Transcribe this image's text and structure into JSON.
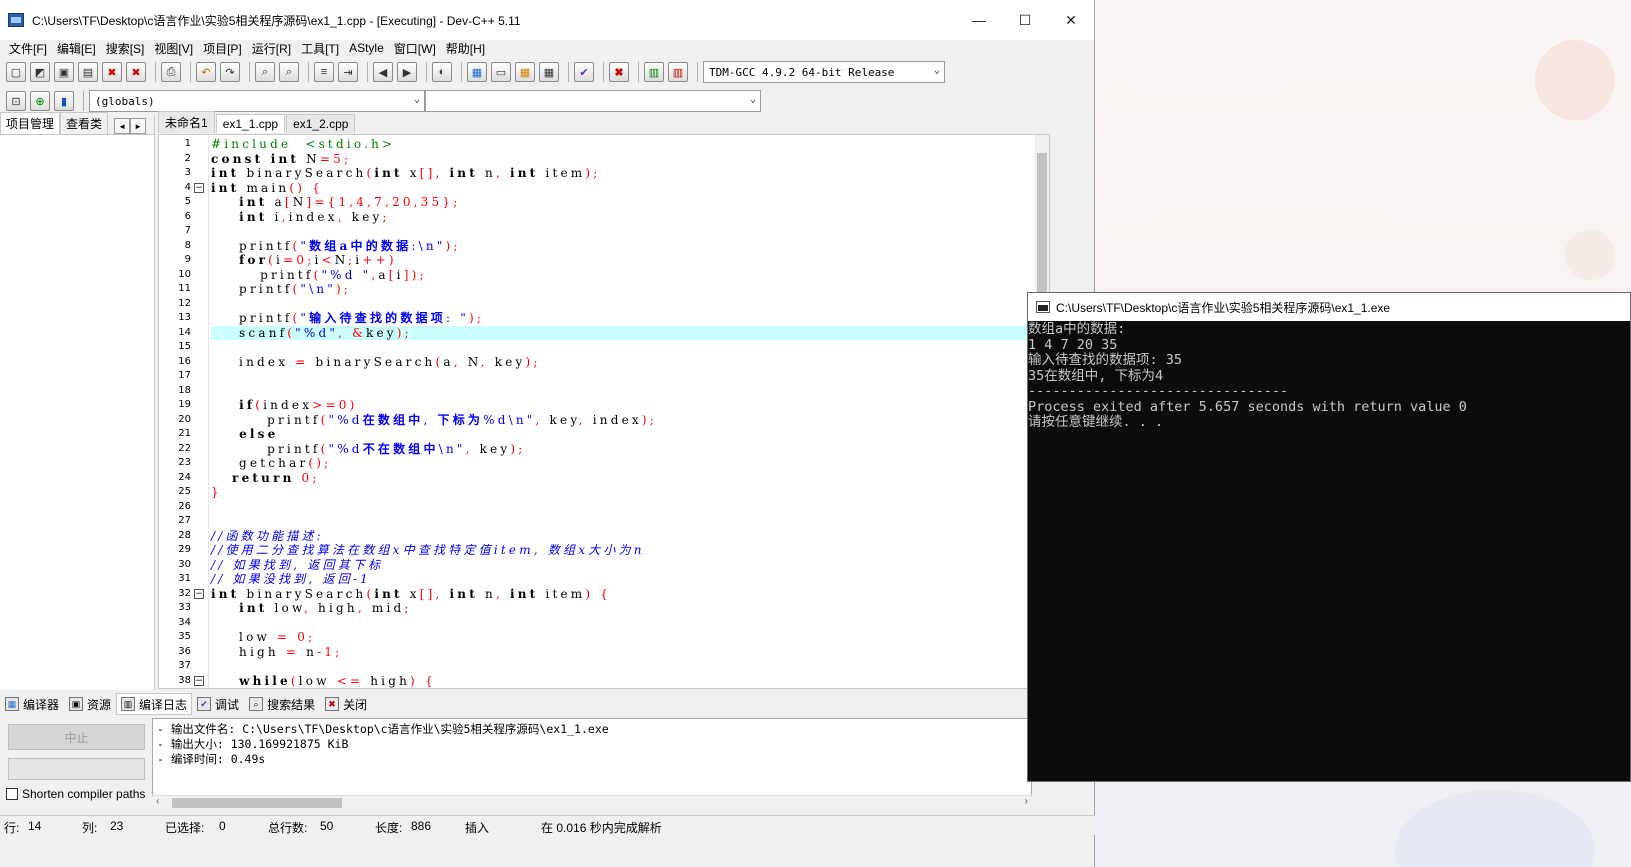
{
  "window": {
    "title": "C:\\Users\\TF\\Desktop\\c语言作业\\实验5相关程序源码\\ex1_1.cpp - [Executing] - Dev-C++ 5.11",
    "minimize": "—",
    "maximize": "☐",
    "close": "✕"
  },
  "menu": [
    "文件[F]",
    "编辑[E]",
    "搜索[S]",
    "视图[V]",
    "项目[P]",
    "运行[R]",
    "工具[T]",
    "AStyle",
    "窗口[W]",
    "帮助[H]"
  ],
  "toolbar": {
    "compiler_select": "TDM-GCC 4.9.2 64-bit Release",
    "class_select": "(globals)",
    "member_select": ""
  },
  "left_panel": {
    "tabs": [
      "项目管理",
      "查看类"
    ],
    "nav_prev": "◄",
    "nav_next": "►"
  },
  "editor": {
    "tabs": [
      "未命名1",
      "ex1_1.cpp",
      "ex1_2.cpp"
    ],
    "active_tab": 1,
    "highlight_line": 14
  },
  "code": [
    {
      "n": "1",
      "html": "<span class=\"pp\">#include  &lt;stdio.h&gt;</span>"
    },
    {
      "n": "2",
      "html": "<span class=\"kw\">const int</span> N<span class=\"sym\">=</span><span class=\"num\">5</span><span class=\"sym\">;</span>"
    },
    {
      "n": "3",
      "html": "<span class=\"kw\">int</span> binarySearch<span class=\"sym\">(</span><span class=\"kw\">int</span> x<span class=\"sym\">[],</span> <span class=\"kw\">int</span> n<span class=\"sym\">,</span> <span class=\"kw\">int</span> item<span class=\"sym\">);</span>"
    },
    {
      "n": "4",
      "fold": "−",
      "html": "<span class=\"kw\">int</span> main<span class=\"sym\">()</span> <span class=\"sym\">{</span>"
    },
    {
      "n": "5",
      "html": "    <span class=\"kw\">int</span> a<span class=\"sym\">[</span>N<span class=\"sym\">]={</span><span class=\"num\">1,4,7,20,35</span><span class=\"sym\">};</span>"
    },
    {
      "n": "6",
      "html": "    <span class=\"kw\">int</span> i<span class=\"sym\">,</span>index<span class=\"sym\">,</span> key<span class=\"sym\">;</span>"
    },
    {
      "n": "7",
      "html": ""
    },
    {
      "n": "8",
      "html": "    printf<span class=\"sym\">(</span><span class=\"str\">\"<b>数组a中的数据</b>:\\n\"</span><span class=\"sym\">);</span>"
    },
    {
      "n": "9",
      "html": "    <span class=\"kw\">for</span><span class=\"sym\">(</span>i<span class=\"sym\">=</span><span class=\"num\">0</span><span class=\"sym\">;</span>i<span class=\"sym\">&lt;</span>N<span class=\"sym\">;</span>i<span class=\"sym\">++)</span>"
    },
    {
      "n": "10",
      "html": "       printf<span class=\"sym\">(</span><span class=\"str\">\"%d \"</span><span class=\"sym\">,</span>a<span class=\"sym\">[</span>i<span class=\"sym\">]);</span>"
    },
    {
      "n": "11",
      "html": "    printf<span class=\"sym\">(</span><span class=\"str\">\"\\n\"</span><span class=\"sym\">);</span>"
    },
    {
      "n": "12",
      "html": ""
    },
    {
      "n": "13",
      "html": "    printf<span class=\"sym\">(</span><span class=\"str\">\"<b>输入待查找的数据项</b>: \"</span><span class=\"sym\">);</span>"
    },
    {
      "n": "14",
      "html": "    scanf<span class=\"sym\">(</span><span class=\"str\">\"%d\"</span><span class=\"sym\">,</span> <span class=\"sym\">&amp;</span>key<span class=\"sym\">);</span>"
    },
    {
      "n": "15",
      "html": ""
    },
    {
      "n": "16",
      "html": "    index <span class=\"sym\">=</span> binarySearch<span class=\"sym\">(</span>a<span class=\"sym\">,</span> N<span class=\"sym\">,</span> key<span class=\"sym\">);</span>"
    },
    {
      "n": "17",
      "html": ""
    },
    {
      "n": "18",
      "html": ""
    },
    {
      "n": "19",
      "html": "    <span class=\"kw\">if</span><span class=\"sym\">(</span>index<span class=\"sym\">&gt;=</span><span class=\"num\">0</span><span class=\"sym\">)</span>"
    },
    {
      "n": "20",
      "html": "        printf<span class=\"sym\">(</span><span class=\"str\">\"%d<b>在数组中</b>, <b>下标为</b>%d\\n\"</span><span class=\"sym\">,</span> key<span class=\"sym\">,</span> index<span class=\"sym\">);</span>"
    },
    {
      "n": "21",
      "html": "    <span class=\"kw\">else</span>"
    },
    {
      "n": "22",
      "html": "        printf<span class=\"sym\">(</span><span class=\"str\">\"%d<b>不在数组中</b>\\n\"</span><span class=\"sym\">,</span> key<span class=\"sym\">);</span>"
    },
    {
      "n": "23",
      "html": "    getchar<span class=\"sym\">();</span>"
    },
    {
      "n": "24",
      "html": "   <span class=\"kw\">return</span> <span class=\"num\">0</span><span class=\"sym\">;</span>"
    },
    {
      "n": "25",
      "html": "<span class=\"sym\">}</span>"
    },
    {
      "n": "26",
      "html": ""
    },
    {
      "n": "27",
      "html": ""
    },
    {
      "n": "28",
      "html": "<span class=\"cm\">//函数功能描述:</span>"
    },
    {
      "n": "29",
      "html": "<span class=\"cm\">//使用二分查找算法在数组x中查找特定值item, 数组x大小为n</span>"
    },
    {
      "n": "30",
      "html": "<span class=\"cm\">// 如果找到, 返回其下标</span>"
    },
    {
      "n": "31",
      "html": "<span class=\"cm\">// 如果没找到, 返回-1</span>"
    },
    {
      "n": "32",
      "fold": "−",
      "html": "<span class=\"kw\">int</span> binarySearch<span class=\"sym\">(</span><span class=\"kw\">int</span> x<span class=\"sym\">[],</span> <span class=\"kw\">int</span> n<span class=\"sym\">,</span> <span class=\"kw\">int</span> item<span class=\"sym\">)</span> <span class=\"sym\">{</span>"
    },
    {
      "n": "33",
      "html": "    <span class=\"kw\">int</span> low<span class=\"sym\">,</span> high<span class=\"sym\">,</span> mid<span class=\"sym\">;</span>"
    },
    {
      "n": "34",
      "html": ""
    },
    {
      "n": "35",
      "html": "    low <span class=\"sym\">=</span> <span class=\"num\">0</span><span class=\"sym\">;</span>"
    },
    {
      "n": "36",
      "html": "    high <span class=\"sym\">=</span> n<span class=\"sym\">-</span><span class=\"num\">1</span><span class=\"sym\">;</span>"
    },
    {
      "n": "37",
      "html": ""
    },
    {
      "n": "38",
      "fold": "−",
      "html": "    <span class=\"kw\">while</span><span class=\"sym\">(</span>low <span class=\"sym\">&lt;=</span> high<span class=\"sym\">)</span> <span class=\"sym\">{</span>"
    }
  ],
  "bottom_tabs": [
    {
      "label": "编译器",
      "icon": "compiler-icon"
    },
    {
      "label": "资源",
      "icon": "resources-icon"
    },
    {
      "label": "编译日志",
      "icon": "compile-log-icon"
    },
    {
      "label": "调试",
      "icon": "debug-icon"
    },
    {
      "label": "搜索结果",
      "icon": "search-results-icon"
    },
    {
      "label": "关闭",
      "icon": "close-panel-icon"
    }
  ],
  "bottom_panel": {
    "stop_button": "中止",
    "shorten_label": "Shorten compiler paths",
    "log": [
      "- 输出文件名: C:\\Users\\TF\\Desktop\\c语言作业\\实验5相关程序源码\\ex1_1.exe",
      "- 输出大小: 130.169921875 KiB",
      "- 编译时间: 0.49s"
    ]
  },
  "status": {
    "row_label": "行:",
    "row": "14",
    "col_label": "列:",
    "col": "23",
    "sel_label": "已选择:",
    "sel": "0",
    "lines_label": "总行数:",
    "lines": "50",
    "len_label": "长度:",
    "len": "886",
    "mode": "插入",
    "parse": "在 0.016 秒内完成解析"
  },
  "console": {
    "title": "C:\\Users\\TF\\Desktop\\c语言作业\\实验5相关程序源码\\ex1_1.exe",
    "lines": [
      "数组a中的数据:",
      "1 4 7 20 35",
      "输入待查找的数据项: 35",
      "35在数组中, 下标为4",
      "",
      "--------------------------------",
      "Process exited after 5.657 seconds with return value 0",
      "请按任意键继续. . ."
    ]
  }
}
